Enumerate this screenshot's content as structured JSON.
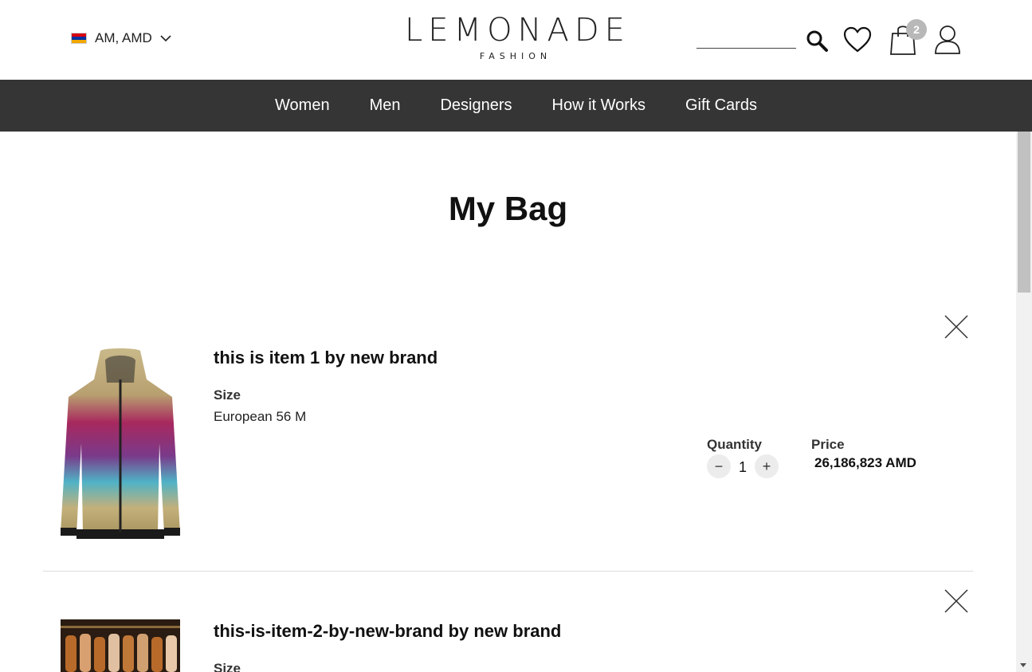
{
  "header": {
    "locale": "AM, AMD",
    "logo_main": "LEMONADE",
    "logo_sub": "FASHION",
    "cart_count": "2",
    "search": {
      "value": "",
      "placeholder": ""
    }
  },
  "nav": {
    "items": [
      "Women",
      "Men",
      "Designers",
      "How it Works",
      "Gift Cards"
    ]
  },
  "page": {
    "title": "My Bag"
  },
  "cart": {
    "items": [
      {
        "name": "this is item 1 by new brand",
        "size_label": "Size",
        "size_value": "European 56 M",
        "quantity_label": "Quantity",
        "quantity": "1",
        "price_label": "Price",
        "price": "26,186,823 AMD"
      },
      {
        "name": "this-is-item-2-by-new-brand by new brand",
        "size_label": "Size"
      }
    ]
  },
  "colors": {
    "nav_bg": "#353535",
    "badge": "#b8b8b8",
    "flag": [
      "#d90012",
      "#0033a0",
      "#f2a800"
    ]
  },
  "icons": [
    "chevron-down-icon",
    "search-icon",
    "heart-icon",
    "shopping-bag-icon",
    "user-icon",
    "close-icon",
    "minus-icon",
    "plus-icon"
  ]
}
